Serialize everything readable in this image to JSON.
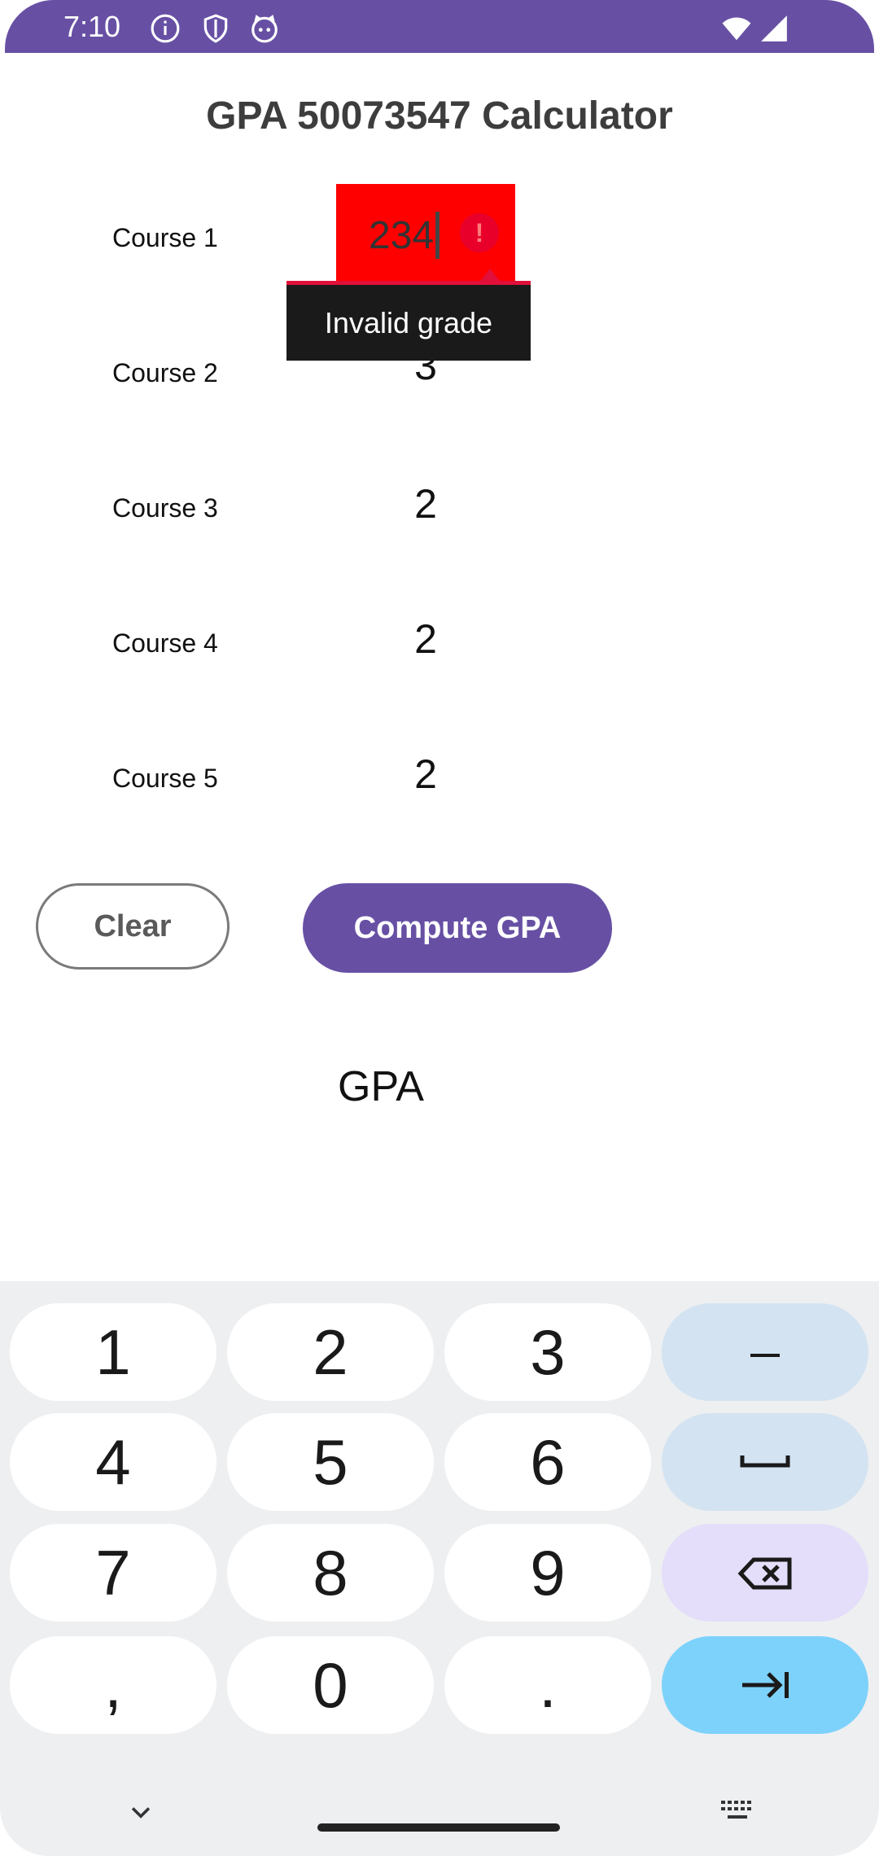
{
  "status_bar": {
    "time": "7:10"
  },
  "app": {
    "title": "GPA 50073547 Calculator"
  },
  "courses": [
    {
      "label": "Course 1",
      "value": "234"
    },
    {
      "label": "Course 2",
      "value": "3"
    },
    {
      "label": "Course 3",
      "value": "2"
    },
    {
      "label": "Course 4",
      "value": "2"
    },
    {
      "label": "Course 5",
      "value": "2"
    }
  ],
  "error": {
    "message": "Invalid grade"
  },
  "buttons": {
    "clear": "Clear",
    "compute": "Compute GPA"
  },
  "result": {
    "label": "GPA"
  },
  "keyboard": {
    "keys": [
      "1",
      "2",
      "3",
      "–",
      "4",
      "5",
      "6",
      "␣",
      "7",
      "8",
      "9",
      "⌫",
      ",",
      "0",
      ".",
      "⇥"
    ]
  },
  "colors": {
    "accent": "#6750a4",
    "error_field": "#ff0000",
    "tab_key": "#7dd2fb"
  }
}
